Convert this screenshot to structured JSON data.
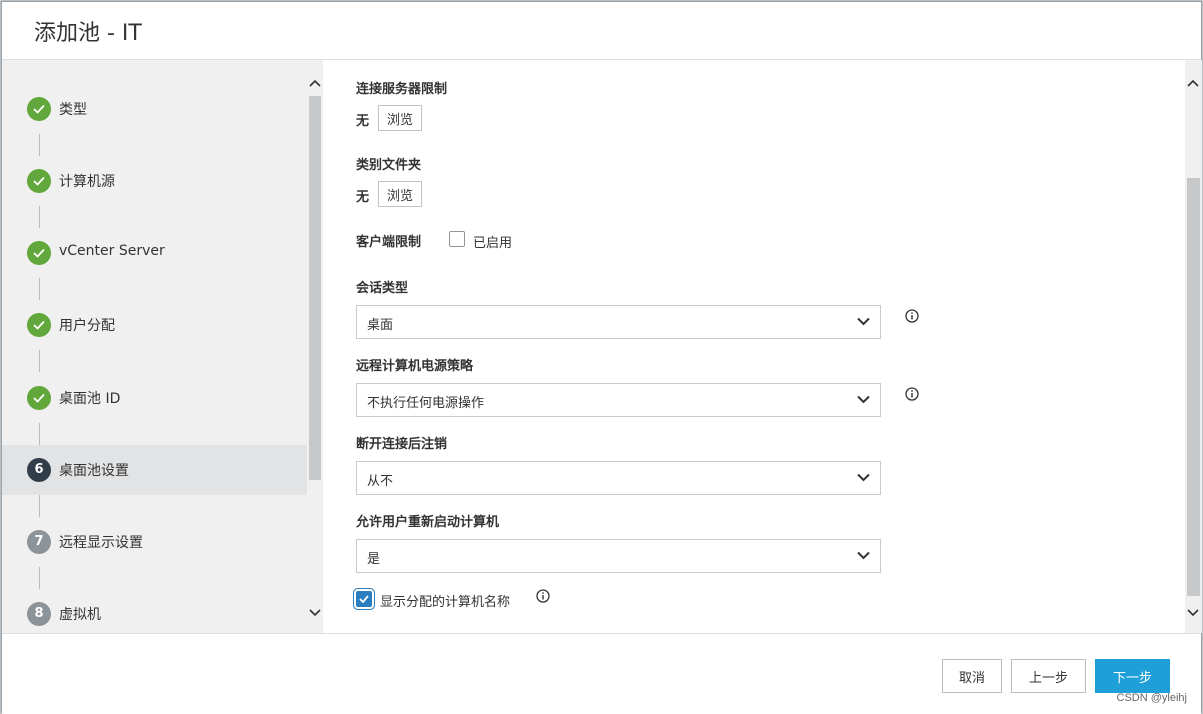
{
  "dialog": {
    "title": "添加池 - IT"
  },
  "steps": [
    {
      "number": "",
      "label": "类型",
      "state": "done"
    },
    {
      "number": "",
      "label": "计算机源",
      "state": "done"
    },
    {
      "number": "",
      "label": "vCenter Server",
      "state": "done"
    },
    {
      "number": "",
      "label": "用户分配",
      "state": "done"
    },
    {
      "number": "",
      "label": "桌面池 ID",
      "state": "done"
    },
    {
      "number": "6",
      "label": "桌面池设置",
      "state": "current"
    },
    {
      "number": "7",
      "label": "远程显示设置",
      "state": "pending"
    },
    {
      "number": "8",
      "label": "虚拟机",
      "state": "pending"
    }
  ],
  "form": {
    "server_limit": {
      "label": "连接服务器限制",
      "value": "无",
      "browse": "浏览"
    },
    "category_folder": {
      "label": "类别文件夹",
      "value": "无",
      "browse": "浏览"
    },
    "client_limit": {
      "label": "客户端限制",
      "checkbox_label": "已启用",
      "checked": false
    },
    "session_type": {
      "label": "会话类型",
      "value": "桌面"
    },
    "power_policy": {
      "label": "远程计算机电源策略",
      "value": "不执行任何电源操作"
    },
    "logoff": {
      "label": "断开连接后注销",
      "value": "从不"
    },
    "allow_restart": {
      "label": "允许用户重新启动计算机",
      "value": "是"
    },
    "show_name": {
      "label": "显示分配的计算机名称",
      "checked": true
    }
  },
  "footer": {
    "cancel": "取消",
    "back": "上一步",
    "next": "下一步",
    "watermark": "CSDN @yleihj"
  },
  "colors": {
    "done": "#62a73b",
    "current": "#313d48",
    "pending": "#8c9399",
    "primary": "#1f9fd8"
  }
}
